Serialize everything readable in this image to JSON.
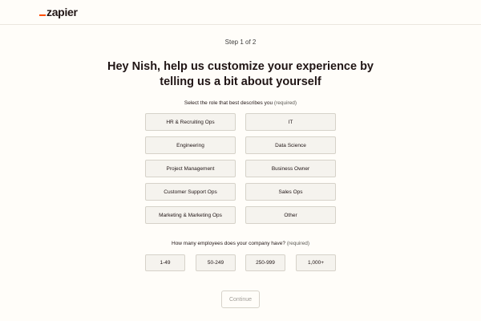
{
  "brand": {
    "name": "zapier",
    "accent_color": "#ff4f00"
  },
  "step_text": "Step 1 of 2",
  "headline": {
    "line1": "Hey Nish, help us customize your experience by",
    "line2": "telling us a bit about yourself"
  },
  "role_section": {
    "label": "Select the role that best describes you",
    "required": "(required)",
    "options": [
      "HR & Recruiting Ops",
      "IT",
      "Engineering",
      "Data Science",
      "Project Management",
      "Business Owner",
      "Customer Support Ops",
      "Sales Ops",
      "Marketing & Marketing Ops",
      "Other"
    ]
  },
  "employee_section": {
    "label": "How many employees does your company have?",
    "required": "(required)",
    "options": [
      "1-49",
      "50-249",
      "250-999",
      "1,000+"
    ]
  },
  "continue_label": "Continue"
}
